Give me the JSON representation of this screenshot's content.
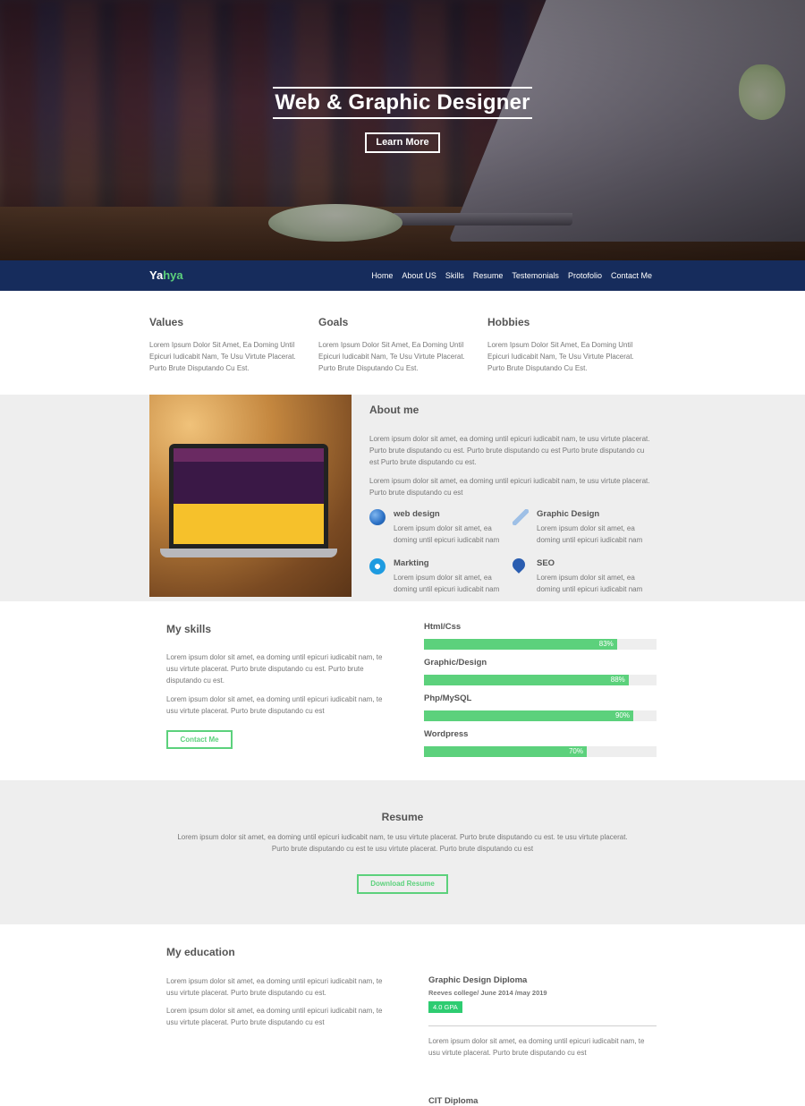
{
  "hero": {
    "title": "Web & Graphic Designer",
    "button": "Learn More"
  },
  "nav": {
    "brand_part1": "Ya",
    "brand_part2": "hya",
    "items": [
      "Home",
      "About US",
      "Skills",
      "Resume",
      "Testemonials",
      "Protofolio",
      "Contact Me"
    ]
  },
  "values": [
    {
      "title": "Values",
      "text": "Lorem Ipsum Dolor Sit Amet, Ea Doming Until Epicuri Iudicabit Nam, Te Usu Virtute Placerat. Purto Brute Disputando Cu Est."
    },
    {
      "title": "Goals",
      "text": "Lorem Ipsum Dolor Sit Amet, Ea Doming Until Epicuri Iudicabit Nam, Te Usu Virtute Placerat. Purto Brute Disputando Cu Est."
    },
    {
      "title": "Hobbies",
      "text": "Lorem Ipsum Dolor Sit Amet, Ea Doming Until Epicuri Iudicabit Nam, Te Usu Virtute Placerat. Purto Brute Disputando Cu Est."
    }
  ],
  "about": {
    "title": "About me",
    "p1": "Lorem ipsum dolor sit amet, ea doming until epicuri iudicabit nam, te usu virtute placerat. Purto brute disputando cu est. Purto brute disputando cu est Purto brute disputando cu est Purto brute disputando cu est.",
    "p2": "Lorem ipsum dolor sit amet, ea doming until epicuri iudicabit nam, te usu virtute placerat. Purto brute disputando cu est",
    "services": [
      {
        "title": "web design",
        "text": "Lorem ipsum dolor sit amet, ea doming until epicuri iudicabit nam",
        "icon": "globe-icon",
        "color": "#2a6fc4"
      },
      {
        "title": "Graphic Design",
        "text": "Lorem ipsum dolor sit amet, ea doming until epicuri iudicabit nam",
        "icon": "pencil-icon",
        "color": "#9fc0e6"
      },
      {
        "title": "Markting",
        "text": "Lorem ipsum dolor sit amet, ea doming until epicuri iudicabit nam",
        "icon": "people-icon",
        "color": "#1e9be0"
      },
      {
        "title": "SEO",
        "text": "Lorem ipsum dolor sit amet, ea doming until epicuri iudicabit nam",
        "icon": "pin-icon",
        "color": "#2a5db0"
      }
    ]
  },
  "skills": {
    "title": "My skills",
    "p1": "Lorem ipsum dolor sit amet, ea doming until epicuri iudicabit nam, te usu virtute placerat. Purto brute disputando cu est. Purto brute disputando cu est.",
    "p2": "Lorem ipsum dolor sit amet, ea doming until epicuri iudicabit nam, te usu virtute placerat. Purto brute disputando cu est",
    "button": "Contact Me",
    "bars": [
      {
        "label": "Html/Css",
        "value": 83,
        "text": "83%"
      },
      {
        "label": "Graphic/Design",
        "value": 88,
        "text": "88%"
      },
      {
        "label": "Php/MySQL",
        "value": 90,
        "text": "90%"
      },
      {
        "label": "Wordpress",
        "value": 70,
        "text": "70%"
      }
    ]
  },
  "resume": {
    "title": "Resume",
    "text": "Lorem ipsum dolor sit amet, ea doming until epicuri iudicabit nam, te usu virtute placerat. Purto brute disputando cu est. te usu virtute placerat. Purto brute disputando cu est te usu virtute placerat. Purto brute disputando cu est",
    "button": "Download Resume"
  },
  "education": {
    "title": "My education",
    "p1": "Lorem ipsum dolor sit amet, ea doming until epicuri iudicabit nam, te usu virtute placerat. Purto brute disputando cu est.",
    "p2": "Lorem ipsum dolor sit amet, ea doming until epicuri iudicabit nam, te usu virtute placerat. Purto brute disputando cu est",
    "degree_title": "Graphic Design Diploma",
    "degree_sub": "Reeves college/ June 2014 /may 2019",
    "gpa": "4.0 GPA",
    "degree_text": "Lorem ipsum dolor sit amet, ea doming until epicuri iudicabit nam, te usu virtute placerat. Purto brute disputando cu est",
    "next_title": "CIT Diploma"
  },
  "colors": {
    "accent": "#5cd17c",
    "nav_bg": "#162c5c",
    "gpa_bg": "#2ecc71"
  }
}
